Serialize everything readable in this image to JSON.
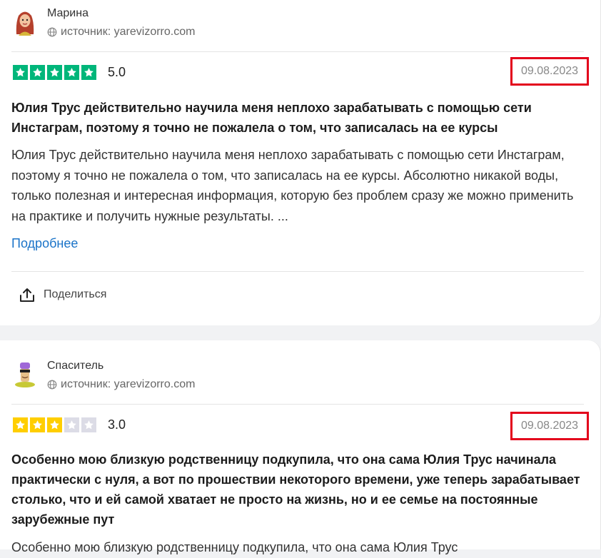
{
  "reviews": [
    {
      "author": "Марина",
      "source": "источник: yarevizorro.com",
      "rating": 5,
      "rating_text": "5.0",
      "date": "09.08.2023",
      "title": "Юлия Трус действительно научила меня неплохо зарабатывать с помощью сети Инстаграм, поэтому я точно не пожалела о том, что записалась на ее курсы",
      "body": "Юлия Трус действительно научила меня неплохо зарабатывать с помощью сети Инстаграм, поэтому я точно не пожалела о том, что записалась на ее курсы. Абсолютно никакой воды, только полезная и интересная информация, которую без проблем сразу же можно применить на практике и получить нужные результаты. ...",
      "more_label": "Подробнее",
      "share_label": "Поделиться",
      "star_color": "#00b67a",
      "avatar_icon": "woman-avatar-icon"
    },
    {
      "author": "Спаситель",
      "source": "источник: yarevizorro.com",
      "rating": 3,
      "rating_text": "3.0",
      "date": "09.08.2023",
      "title": "Особенно мою близкую родственницу подкупила, что она сама Юлия Трус начинала практически с нуля, а вот по прошествии некоторого времени, уже теперь зарабатывает столько, что и ей самой хватает не просто на жизнь, но и ее семье на постоянные зарубежные пут",
      "body": "Особенно мою близкую родственницу подкупила, что она сама Юлия Трус",
      "star_color": "#ffce00",
      "avatar_icon": "character-avatar-icon"
    }
  ],
  "colors": {
    "highlight_border": "#e3001b",
    "link": "#1a73c8",
    "empty_star": "#dcdce6"
  }
}
